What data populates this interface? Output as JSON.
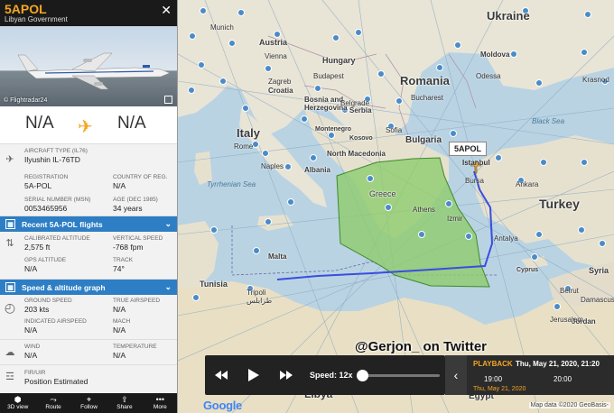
{
  "panel": {
    "callsign": "5APOL",
    "operator": "Libyan Government",
    "photo_credit": "© Flightradar24",
    "origin": "N/A",
    "destination": "N/A",
    "aircraft_type_label": "AIRCRAFT TYPE",
    "aircraft_type_code": "(IL76)",
    "aircraft_type": "Ilyushin IL-76TD",
    "registration_label": "REGISTRATION",
    "registration": "5A-POL",
    "country_label": "COUNTRY OF REG.",
    "country": "N/A",
    "serial_label": "SERIAL NUMBER (MSN)",
    "serial": "0053465956",
    "age_label": "AGE (DEC 1985)",
    "age": "34 years",
    "recent_flights": "Recent 5A-POL flights",
    "cal_alt_label": "CALIBRATED ALTITUDE",
    "cal_alt": "2,575 ft",
    "vspeed_label": "VERTICAL SPEED",
    "vspeed": "-768 fpm",
    "gps_alt_label": "GPS ALTITUDE",
    "gps_alt": "N/A",
    "track_label": "TRACK",
    "track": "74°",
    "speed_graph": "Speed & altitude graph",
    "gs_label": "GROUND SPEED",
    "gs": "203 kts",
    "tas_label": "TRUE AIRSPEED",
    "tas": "N/A",
    "ias_label": "INDICATED AIRSPEED",
    "ias": "N/A",
    "mach_label": "MACH",
    "mach": "N/A",
    "wind_label": "WIND",
    "wind": "N/A",
    "temp_label": "TEMPERATURE",
    "temp": "N/A",
    "fir_label": "FIR/UIR",
    "fir": "Position Estimated"
  },
  "footer": {
    "view3d": "3D view",
    "route": "Route",
    "follow": "Follow",
    "share": "Share",
    "more": "More"
  },
  "map": {
    "countries": {
      "ukraine": "Ukraine",
      "romania": "Romania",
      "hungary": "Hungary",
      "austria": "Austria",
      "croatia": "Croatia",
      "bosnia": "Bosnia and Herzegovina",
      "serbia": "Serbia",
      "montenegro": "Montenegro",
      "kosovo": "Kosovo",
      "north_macedonia": "North Macedonia",
      "albania": "Albania",
      "bulgaria": "Bulgaria",
      "italy": "Italy",
      "greece": "Greece",
      "turkey": "Turkey",
      "tunisia": "Tunisia",
      "malta": "Malta",
      "cyprus": "Cyprus",
      "libya": "Libya",
      "egypt": "Egypt",
      "syria": "Syria",
      "jordan": "Jordan",
      "moldova": "Moldova"
    },
    "cities": {
      "bucharest": "Bucharest",
      "istanbul": "Istanbul",
      "ankara": "Ankara",
      "athens": "Athens",
      "tripoli": "Tripoli",
      "tripoli_ar": "طرابلس",
      "bursa": "Bursa",
      "beirut": "Beirut",
      "damascus": "Damascus",
      "jerusalem": "Jerusalem",
      "izmir": "Izmir",
      "antalya": "Antalya",
      "naples": "Naples",
      "rome": "Rome",
      "sofia": "Sofia",
      "belgrade": "Belgrade",
      "budapest": "Budapest",
      "vienna": "Vienna",
      "munich": "Munich",
      "zagreb": "Zagreb",
      "krasnodar": "Krasnod",
      "odessa": "Odessa",
      "tyrrhenian": "Tyrrhenian Sea",
      "black_sea": "Black Sea"
    },
    "aircraft_tag": "5APOL",
    "watermark": "@Gerjon_ on Twitter",
    "google": "Google",
    "copyright": "Map data ©2020 GeoBasis-"
  },
  "playback": {
    "speed_label": "Speed: 12x",
    "speed_fraction": 0.0,
    "title": "PLAYBACK",
    "datetime": "Thu, May 21, 2020, 21:20",
    "time_a": "19:00",
    "time_b": "20:00",
    "date_sub": "Thu, May 21, 2020"
  }
}
